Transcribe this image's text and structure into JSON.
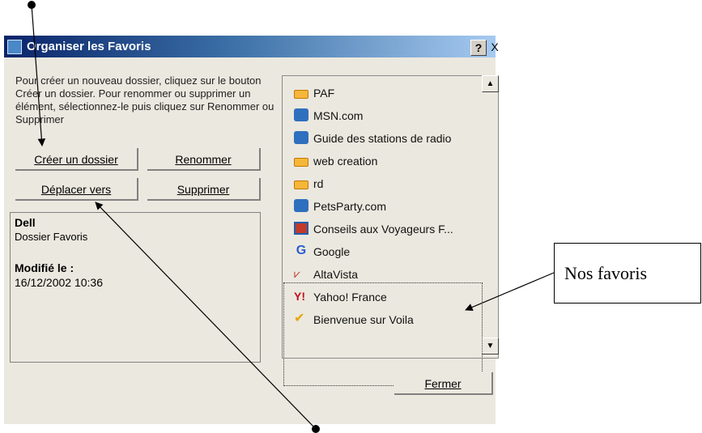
{
  "window": {
    "title": "Organiser les Favoris",
    "help_label": "?",
    "close_label": "X"
  },
  "help_text": "Pour créer un nouveau dossier, cliquez sur le bouton Créer un dossier. Pour renommer ou supprimer un élément, sélectionnez-le puis cliquez sur Renommer ou Supprimer",
  "buttons": {
    "create_folder": "Créer un dossier",
    "rename": "Renommer",
    "move_to": "Déplacer vers",
    "delete": "Supprimer",
    "close": "Fermer"
  },
  "info": {
    "name": "Dell",
    "type": "Dossier Favoris",
    "modified_label": "Modifié le :",
    "modified_date": "16/12/2002 10:36"
  },
  "favorites": [
    {
      "label": "PAF",
      "icon": "folder-icon"
    },
    {
      "label": "MSN.com",
      "icon": "ie-page-icon"
    },
    {
      "label": "Guide des stations de radio",
      "icon": "radio-guide-icon"
    },
    {
      "label": "web creation",
      "icon": "folder-icon"
    },
    {
      "label": "rd",
      "icon": "folder-icon"
    },
    {
      "label": "PetsParty.com",
      "icon": "ie-page-icon"
    },
    {
      "label": "Conseils aux Voyageurs F...",
      "icon": "web-page-icon"
    },
    {
      "label": "Google",
      "icon": "google-icon"
    },
    {
      "label": "AltaVista",
      "icon": "altavista-icon"
    },
    {
      "label": "Yahoo! France",
      "icon": "yahoo-icon"
    },
    {
      "label": "Bienvenue sur Voila",
      "icon": "voila-icon"
    }
  ],
  "scroll": {
    "up": "▲",
    "down": "▼"
  },
  "callout": {
    "text": "Nos favoris"
  },
  "colors": {
    "titlebar_start": "#0a246a",
    "titlebar_end": "#a6caf0",
    "dialog_bg": "#ebe8df"
  }
}
